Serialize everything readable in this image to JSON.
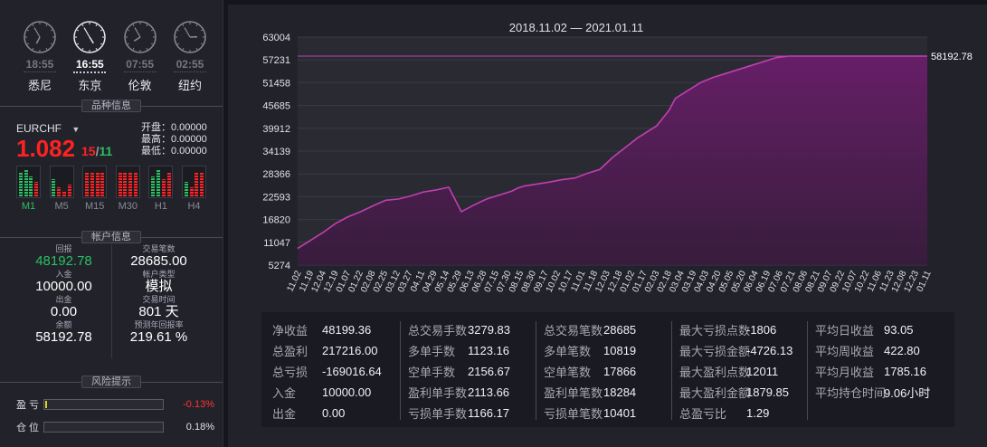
{
  "clocks": [
    {
      "time": "18:55",
      "city": "悉尼",
      "h": 18,
      "m": 55,
      "active": false
    },
    {
      "time": "16:55",
      "city": "东京",
      "h": 16,
      "m": 55,
      "active": true
    },
    {
      "time": "07:55",
      "city": "伦敦",
      "h": 7,
      "m": 55,
      "active": false
    },
    {
      "time": "02:55",
      "city": "纽约",
      "h": 2,
      "m": 55,
      "active": false
    }
  ],
  "symbol_section_title": "品种信息",
  "symbol": {
    "name": "EURCHF",
    "price_main": "1.082",
    "price_sub_a": "15",
    "price_sep": "/",
    "price_sub_b": "11",
    "open": "开盘：0.00000",
    "high": "最高：0.00000",
    "low": "最低：0.00000"
  },
  "timeframes": [
    {
      "label": "M1",
      "active": true,
      "levels": [
        0.8,
        0.9,
        0.7,
        0.5
      ],
      "colors": [
        "#29c060",
        "#29c060",
        "#29c060",
        "#ff2222"
      ]
    },
    {
      "label": "M5",
      "active": false,
      "levels": [
        0.6,
        0.3,
        0.2,
        0.4
      ],
      "colors": [
        "#29c060",
        "#ff2222",
        "#ff2222",
        "#ff2222"
      ]
    },
    {
      "label": "M15",
      "active": false,
      "levels": [
        0.8,
        0.8,
        0.8,
        0.8
      ],
      "colors": [
        "#ff2222",
        "#ff2222",
        "#ff2222",
        "#ff2222"
      ]
    },
    {
      "label": "M30",
      "active": false,
      "levels": [
        0.8,
        0.8,
        0.8,
        0.8
      ],
      "colors": [
        "#ff2222",
        "#ff2222",
        "#ff2222",
        "#ff2222"
      ]
    },
    {
      "label": "H1",
      "active": false,
      "levels": [
        0.7,
        0.9,
        0.6,
        0.8
      ],
      "colors": [
        "#29c060",
        "#29c060",
        "#ff2222",
        "#ff2222"
      ]
    },
    {
      "label": "H4",
      "active": false,
      "levels": [
        0.5,
        0.3,
        0.8,
        0.8
      ],
      "colors": [
        "#29c060",
        "#ff2222",
        "#ff2222",
        "#ff2222"
      ]
    }
  ],
  "account_section_title": "帐户信息",
  "account": {
    "left": [
      {
        "label": "回报",
        "value": "48192.78",
        "green": true
      },
      {
        "label": "入金",
        "value": "10000.00"
      },
      {
        "label": "出金",
        "value": "0.00"
      },
      {
        "label": "余额",
        "value": "58192.78"
      }
    ],
    "right": [
      {
        "label": "交易笔数",
        "value": "28685.00"
      },
      {
        "label": "帐户类型",
        "value": "模拟"
      },
      {
        "label": "交易时间",
        "value": "801 天"
      },
      {
        "label": "预测年回报率",
        "value": "219.61 %"
      }
    ]
  },
  "risk_section_title": "风险提示",
  "risk": [
    {
      "label": "盈亏",
      "value": "-0.13%",
      "fill": 0.01,
      "negative": true
    },
    {
      "label": "仓位",
      "value": "0.18%",
      "fill": 0.0,
      "negative": false
    }
  ],
  "chart_data": {
    "type": "area",
    "title": "2018.11.02 — 2021.01.11",
    "y_ticks": [
      63004,
      57231,
      51458,
      45685,
      39912,
      34139,
      28366,
      22593,
      16820,
      11047,
      5274
    ],
    "ylim": [
      5274,
      63004
    ],
    "x_ticks": [
      "11.02",
      "11.19",
      "12.04",
      "12.19",
      "01.07",
      "01.22",
      "02.08",
      "02.25",
      "03.12",
      "03.27",
      "04.11",
      "04.29",
      "05.14",
      "05.29",
      "06.13",
      "06.28",
      "07.15",
      "07.30",
      "08.15",
      "08.30",
      "09.17",
      "10.02",
      "10.17",
      "11.01",
      "11.18",
      "12.03",
      "12.18",
      "01.02",
      "01.17",
      "02.03",
      "02.18",
      "03.04",
      "03.19",
      "04.03",
      "04.20",
      "05.05",
      "05.20",
      "06.04",
      "06.19",
      "07.06",
      "07.21",
      "08.06",
      "08.21",
      "09.07",
      "09.22",
      "10.07",
      "10.22",
      "11.06",
      "11.23",
      "12.08",
      "12.23",
      "01.11"
    ],
    "x": [
      0,
      2,
      4,
      6,
      8,
      10,
      12,
      14,
      16,
      18,
      20,
      22,
      24,
      26,
      28,
      30,
      32,
      34,
      35,
      36,
      38,
      40,
      42,
      44,
      46,
      48,
      50,
      52,
      54,
      56,
      57,
      58,
      59,
      60,
      62,
      64,
      66,
      68,
      70,
      72,
      74,
      76,
      78,
      80,
      82,
      84,
      86,
      88,
      90,
      92,
      94,
      96,
      98,
      100
    ],
    "values": [
      9500,
      11500,
      13500,
      15800,
      17500,
      18800,
      20300,
      21700,
      22000,
      22800,
      23800,
      24300,
      25000,
      18800,
      20500,
      22000,
      23000,
      24000,
      24800,
      25300,
      25800,
      26300,
      26900,
      27300,
      28500,
      29500,
      32500,
      35000,
      37500,
      39500,
      40500,
      42500,
      44500,
      47500,
      49500,
      51500,
      52800,
      53800,
      54800,
      55800,
      56800,
      57800,
      58192.78,
      58192.78,
      58192.78,
      58192.78,
      58192.78,
      58192.78,
      58192.78,
      58192.78,
      58192.78,
      58192.78,
      58192.78,
      58192.78
    ],
    "last_label": "58192.78",
    "max_line": 58192.78,
    "line_color": "#c040b0",
    "fill_color": "#6a1e6a"
  },
  "stats": [
    [
      {
        "k": "净收益",
        "v": "48199.36"
      },
      {
        "k": "总盈利",
        "v": "217216.00"
      },
      {
        "k": "总亏损",
        "v": "-169016.64"
      },
      {
        "k": "入金",
        "v": "10000.00"
      },
      {
        "k": "出金",
        "v": "0.00"
      }
    ],
    [
      {
        "k": "总交易手数",
        "v": "3279.83"
      },
      {
        "k": "多单手数",
        "v": "1123.16"
      },
      {
        "k": "空单手数",
        "v": "2156.67"
      },
      {
        "k": "盈利单手数",
        "v": "2113.66"
      },
      {
        "k": "亏损单手数",
        "v": "1166.17"
      }
    ],
    [
      {
        "k": "总交易笔数",
        "v": "28685"
      },
      {
        "k": "多单笔数",
        "v": "10819"
      },
      {
        "k": "空单笔数",
        "v": "17866"
      },
      {
        "k": "盈利单笔数",
        "v": "18284"
      },
      {
        "k": "亏损单笔数",
        "v": "10401"
      }
    ],
    [
      {
        "k": "最大亏损点数",
        "v": "-1806"
      },
      {
        "k": "最大亏损金额",
        "v": "-4726.13"
      },
      {
        "k": "最大盈利点数",
        "v": "12011"
      },
      {
        "k": "最大盈利金额",
        "v": "1879.85"
      },
      {
        "k": "总盈亏比",
        "v": "1.29"
      }
    ],
    [
      {
        "k": "平均日收益",
        "v": "93.05"
      },
      {
        "k": "平均周收益",
        "v": "422.80"
      },
      {
        "k": "平均月收益",
        "v": "1785.16"
      },
      {
        "k": "平均持仓时间",
        "v": "9.06小时"
      }
    ]
  ]
}
